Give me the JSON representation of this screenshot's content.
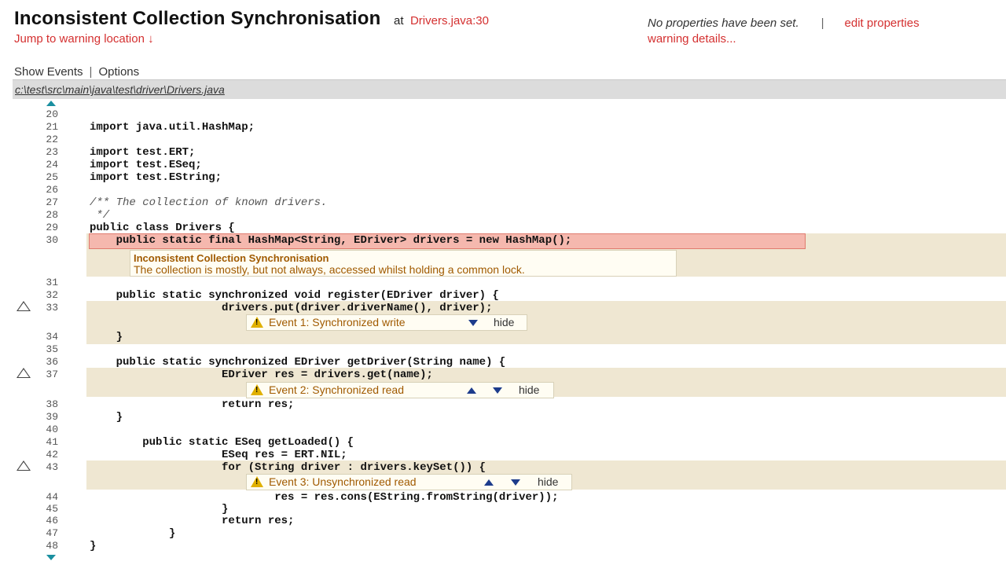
{
  "header": {
    "title": "Inconsistent Collection Synchronisation",
    "at": "at",
    "location_link": "Drivers.java:30",
    "jump_link": "Jump to warning location ↓",
    "no_properties": "No properties have been set.",
    "separator": "|",
    "edit_properties": "edit properties",
    "warning_details": "warning details..."
  },
  "nav": {
    "show_events": "Show Events",
    "separator": "|",
    "options": "Options"
  },
  "file_path": "c:\\test\\src\\main\\java\\test\\driver\\Drivers.java",
  "code_lines": [
    {
      "n": "20",
      "text": ""
    },
    {
      "n": "21",
      "text": "import java.util.HashMap;"
    },
    {
      "n": "22",
      "text": ""
    },
    {
      "n": "23",
      "text": "import test.ERT;"
    },
    {
      "n": "24",
      "text": "import test.ESeq;"
    },
    {
      "n": "25",
      "text": "import test.EString;"
    },
    {
      "n": "26",
      "text": ""
    },
    {
      "n": "27",
      "text": "/** The collection of known drivers."
    },
    {
      "n": "28",
      "text": " */"
    },
    {
      "n": "29",
      "text": "public class Drivers {"
    },
    {
      "n": "30",
      "text": "    public static final HashMap<String, EDriver> drivers = new HashMap();"
    },
    {
      "n": "31",
      "text": ""
    },
    {
      "n": "32",
      "text": "    public static synchronized void register(EDriver driver) {"
    },
    {
      "n": "33",
      "text": "                    drivers.put(driver.driverName(), driver);"
    },
    {
      "n": "34",
      "text": "    }"
    },
    {
      "n": "35",
      "text": ""
    },
    {
      "n": "36",
      "text": "    public static synchronized EDriver getDriver(String name) {"
    },
    {
      "n": "37",
      "text": "                    EDriver res = drivers.get(name);"
    },
    {
      "n": "38",
      "text": "                    return res;"
    },
    {
      "n": "39",
      "text": "    }"
    },
    {
      "n": "40",
      "text": ""
    },
    {
      "n": "41",
      "text": "        public static ESeq getLoaded() {"
    },
    {
      "n": "42",
      "text": "                    ESeq res = ERT.NIL;"
    },
    {
      "n": "43",
      "text": "                    for (String driver : drivers.keySet()) {"
    },
    {
      "n": "44",
      "text": "                            res = res.cons(EString.fromString(driver));"
    },
    {
      "n": "45",
      "text": "                    }"
    },
    {
      "n": "46",
      "text": "                    return res;"
    },
    {
      "n": "47",
      "text": "            }"
    },
    {
      "n": "48",
      "text": "}"
    }
  ],
  "warning": {
    "title": "Inconsistent Collection Synchronisation",
    "description": "The collection is mostly, but not always, accessed whilst holding a common lock."
  },
  "events": [
    {
      "label": "Event 1:  Synchronized write",
      "hide": "hide"
    },
    {
      "label": "Event 2:  Synchronized read",
      "hide": "hide"
    },
    {
      "label": "Event 3:  Unsynchronized read",
      "hide": "hide"
    }
  ],
  "colors": {
    "link": "#d43030",
    "highlight": "#f5b8ae",
    "band": "#efe7d2",
    "scroll_arrow": "#1a8fa0",
    "nav_arrow": "#1d3c8c"
  }
}
